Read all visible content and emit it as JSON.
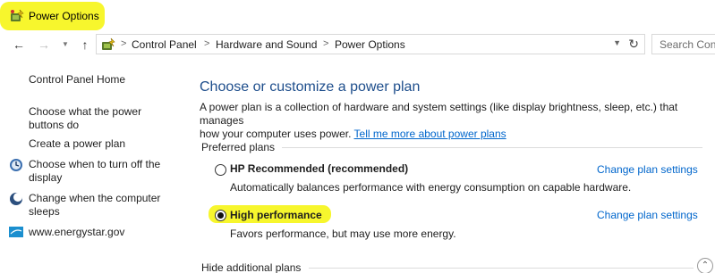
{
  "window": {
    "title": "Power Options",
    "title_icon": "power-options-icon",
    "highlight_color": "#f7f62d"
  },
  "nav": {
    "back_icon": "back-arrow-icon",
    "forward_icon": "forward-arrow-icon",
    "history_icon": "chevron-down-icon",
    "up_icon": "up-arrow-icon"
  },
  "address": {
    "icon": "control-panel-icon",
    "crumbs": [
      "Control Panel",
      "Hardware and Sound",
      "Power Options"
    ],
    "separator": ">",
    "dropdown_icon": "chevron-down-icon",
    "refresh_icon": "refresh-icon"
  },
  "search": {
    "placeholder": "Search Con"
  },
  "sidebar": {
    "home": "Control Panel Home",
    "items": [
      {
        "label_line1": "Choose what the power",
        "label_line2": "buttons do",
        "icon": null
      },
      {
        "label_line1": "Create a power plan",
        "label_line2": "",
        "icon": null
      },
      {
        "label_line1": "Choose when to turn off the",
        "label_line2": "display",
        "icon": "display-icon"
      },
      {
        "label_line1": "Change when the computer",
        "label_line2": "sleeps",
        "icon": "sleep-moon-icon"
      },
      {
        "label_line1": "www.energystar.gov",
        "label_line2": "",
        "icon": "energystar-icon"
      }
    ]
  },
  "main": {
    "heading": "Choose or customize a power plan",
    "intro_line1": "A power plan is a collection of hardware and system settings (like display brightness, sleep, etc.) that manages",
    "intro_line2": "how your computer uses power.",
    "intro_link": "Tell me more about power plans",
    "preferred_label": "Preferred plans",
    "plans": [
      {
        "name": "HP Recommended (recommended)",
        "description": "Automatically balances performance with energy consumption on capable hardware.",
        "link": "Change plan settings",
        "selected": false
      },
      {
        "name": "High performance",
        "description": "Favors performance, but may use more energy.",
        "link": "Change plan settings",
        "selected": true
      }
    ],
    "hide_label": "Hide additional plans",
    "collapse_icon": "chevron-up-icon"
  },
  "colors": {
    "heading": "#1e4e8c",
    "link": "#0066cc",
    "highlight": "#f7f62d"
  }
}
